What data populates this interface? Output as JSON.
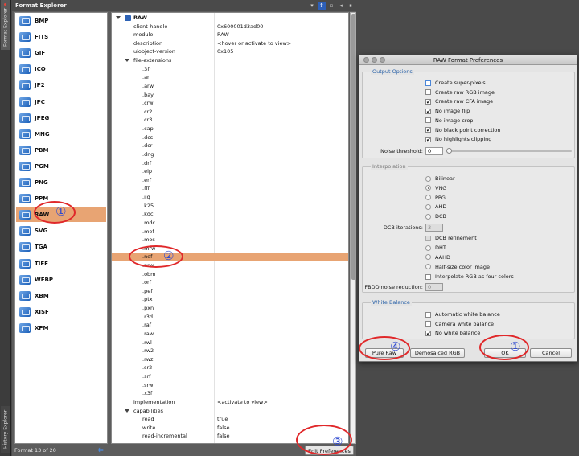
{
  "side_tabs": {
    "format_explorer": "Format Explorer",
    "history_explorer": "History Explorer"
  },
  "explorer": {
    "title": "Format Explorer",
    "formats": [
      "BMP",
      "FITS",
      "GIF",
      "ICO",
      "JP2",
      "JPC",
      "JPEG",
      "MNG",
      "PBM",
      "PGM",
      "PNG",
      "PPM",
      "RAW",
      "SVG",
      "TGA",
      "TIFF",
      "WEBP",
      "XBM",
      "XISF",
      "XPM"
    ],
    "selected_format": "RAW",
    "status": "Format 13 of 20",
    "edit_preferences": "Edit Preferences"
  },
  "tree": [
    {
      "k": "RAW",
      "v": "",
      "lvl": 0,
      "root": true
    },
    {
      "k": "client-handle",
      "v": "0x600001d3ad00",
      "lvl": 1
    },
    {
      "k": "module",
      "v": "RAW",
      "lvl": 1
    },
    {
      "k": "description",
      "v": "<hover or activate to view>",
      "lvl": 1
    },
    {
      "k": "uiobject-version",
      "v": "0x105",
      "lvl": 1
    },
    {
      "k": "file-extensions",
      "v": "",
      "lvl": 1,
      "exp": true
    },
    {
      "k": ".3fr",
      "v": "",
      "lvl": 2
    },
    {
      "k": ".ari",
      "v": "",
      "lvl": 2
    },
    {
      "k": ".arw",
      "v": "",
      "lvl": 2
    },
    {
      "k": ".bay",
      "v": "",
      "lvl": 2
    },
    {
      "k": ".crw",
      "v": "",
      "lvl": 2
    },
    {
      "k": ".cr2",
      "v": "",
      "lvl": 2
    },
    {
      "k": ".cr3",
      "v": "",
      "lvl": 2
    },
    {
      "k": ".cap",
      "v": "",
      "lvl": 2
    },
    {
      "k": ".dcs",
      "v": "",
      "lvl": 2
    },
    {
      "k": ".dcr",
      "v": "",
      "lvl": 2
    },
    {
      "k": ".dng",
      "v": "",
      "lvl": 2
    },
    {
      "k": ".drf",
      "v": "",
      "lvl": 2
    },
    {
      "k": ".eip",
      "v": "",
      "lvl": 2
    },
    {
      "k": ".erf",
      "v": "",
      "lvl": 2
    },
    {
      "k": ".fff",
      "v": "",
      "lvl": 2
    },
    {
      "k": ".iiq",
      "v": "",
      "lvl": 2
    },
    {
      "k": ".k25",
      "v": "",
      "lvl": 2
    },
    {
      "k": ".kdc",
      "v": "",
      "lvl": 2
    },
    {
      "k": ".mdc",
      "v": "",
      "lvl": 2
    },
    {
      "k": ".mef",
      "v": "",
      "lvl": 2
    },
    {
      "k": ".mos",
      "v": "",
      "lvl": 2
    },
    {
      "k": ".mrw",
      "v": "",
      "lvl": 2
    },
    {
      "k": ".nef",
      "v": "",
      "lvl": 2,
      "sel": true
    },
    {
      "k": ".nrw",
      "v": "",
      "lvl": 2
    },
    {
      "k": ".obm",
      "v": "",
      "lvl": 2
    },
    {
      "k": ".orf",
      "v": "",
      "lvl": 2
    },
    {
      "k": ".pef",
      "v": "",
      "lvl": 2
    },
    {
      "k": ".ptx",
      "v": "",
      "lvl": 2
    },
    {
      "k": ".pxn",
      "v": "",
      "lvl": 2
    },
    {
      "k": ".r3d",
      "v": "",
      "lvl": 2
    },
    {
      "k": ".raf",
      "v": "",
      "lvl": 2
    },
    {
      "k": ".raw",
      "v": "",
      "lvl": 2
    },
    {
      "k": ".rwl",
      "v": "",
      "lvl": 2
    },
    {
      "k": ".rw2",
      "v": "",
      "lvl": 2
    },
    {
      "k": ".rwz",
      "v": "",
      "lvl": 2
    },
    {
      "k": ".sr2",
      "v": "",
      "lvl": 2
    },
    {
      "k": ".srf",
      "v": "",
      "lvl": 2
    },
    {
      "k": ".srw",
      "v": "",
      "lvl": 2
    },
    {
      "k": ".x3f",
      "v": "",
      "lvl": 2
    },
    {
      "k": "implementation",
      "v": "<activate to view>",
      "lvl": 1
    },
    {
      "k": "capabilities",
      "v": "",
      "lvl": 1,
      "exp": true
    },
    {
      "k": "read",
      "v": "true",
      "lvl": 2
    },
    {
      "k": "write",
      "v": "false",
      "lvl": 2
    },
    {
      "k": "read-incremental",
      "v": "false",
      "lvl": 2
    }
  ],
  "dialog": {
    "title": "RAW Format Preferences",
    "output_options": {
      "label": "Output Options",
      "items": [
        {
          "label": "Create super-pixels",
          "checked": false,
          "focus": true
        },
        {
          "label": "Create raw RGB image",
          "checked": false
        },
        {
          "label": "Create raw CFA image",
          "checked": true
        },
        {
          "label": "No image flip",
          "checked": true
        },
        {
          "label": "No image crop",
          "checked": false
        },
        {
          "label": "No black point correction",
          "checked": true
        },
        {
          "label": "No highlights clipping",
          "checked": true
        }
      ],
      "noise_label": "Noise threshold:",
      "noise_value": "0"
    },
    "interpolation": {
      "label": "Interpolation",
      "radios": [
        {
          "label": "Bilinear",
          "checked": false
        },
        {
          "label": "VNG",
          "checked": true
        },
        {
          "label": "PPG",
          "checked": false
        },
        {
          "label": "AHD",
          "checked": false
        },
        {
          "label": "DCB",
          "checked": false
        }
      ],
      "dcb_iter_label": "DCB iterations:",
      "dcb_iter_value": "3",
      "dcb_refinement": "DCB refinement",
      "radios2": [
        {
          "label": "DHT",
          "checked": false
        },
        {
          "label": "AAHD",
          "checked": false
        },
        {
          "label": "Half-size color image",
          "checked": false
        }
      ],
      "interp_four": "Interpolate RGB as four colors",
      "fbdd_label": "FBDD noise reduction:",
      "fbdd_value": "0"
    },
    "white_balance": {
      "label": "White Balance",
      "items": [
        {
          "label": "Automatic white balance",
          "checked": false
        },
        {
          "label": "Camera white balance",
          "checked": false
        },
        {
          "label": "No white balance",
          "checked": true
        }
      ]
    },
    "buttons": {
      "pure_raw": "Pure Raw",
      "demosaiced_rgb": "Demosaiced RGB",
      "ok": "OK",
      "cancel": "Cancel"
    }
  },
  "annotations": {
    "n1": "①",
    "n2": "②",
    "n3": "③",
    "n4": "④",
    "color": "#e0282a"
  }
}
